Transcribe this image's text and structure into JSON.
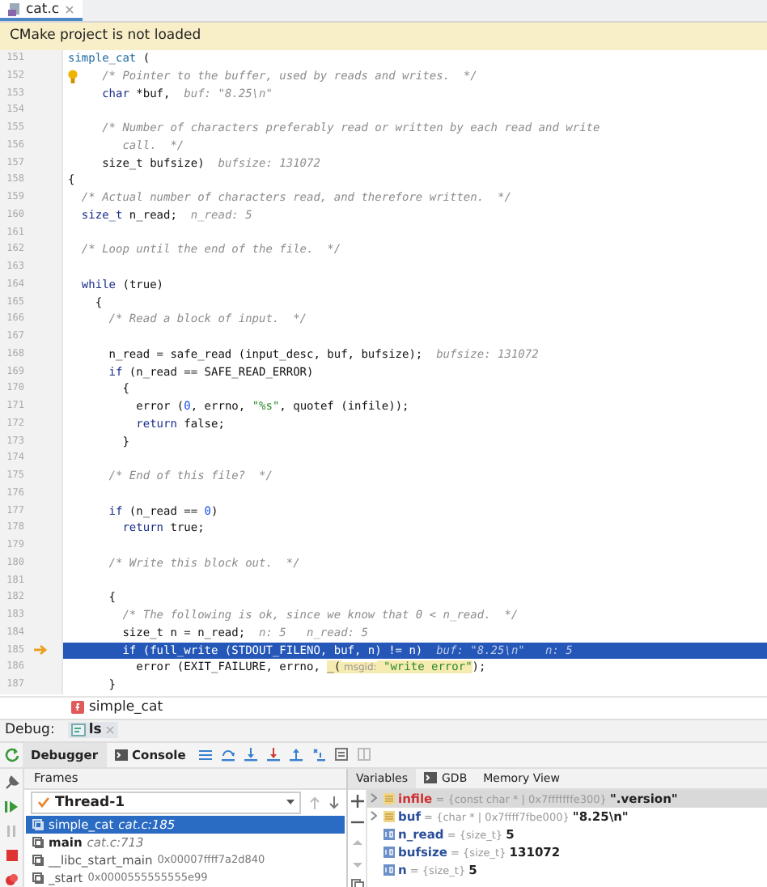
{
  "editor_tabs": [
    {
      "label": "cat.c",
      "selected": true
    }
  ],
  "banner": "CMake project is not loaded",
  "code_lines": [
    {
      "number": "151",
      "kind": "normal",
      "tokens": [
        {
          "kind": "function",
          "text": "simple_cat"
        },
        {
          "kind": "plain",
          "text": " ("
        }
      ]
    },
    {
      "number": "152",
      "kind": "bulb",
      "tokens": [
        {
          "kind": "comment",
          "text": "     /* Pointer to the buffer, used by reads and writes.  */"
        }
      ]
    },
    {
      "number": "153",
      "kind": "normal",
      "tokens": [
        {
          "kind": "keyword",
          "text": "     char"
        },
        {
          "kind": "plain",
          "text": " *buf,"
        },
        {
          "kind": "hint",
          "text": "  buf: \"8.25\\n\""
        }
      ]
    },
    {
      "number": "154",
      "kind": "normal"
    },
    {
      "number": "155",
      "kind": "normal",
      "tokens": [
        {
          "kind": "comment",
          "text": "     /* Number of characters preferably read or written by each read and write"
        }
      ]
    },
    {
      "number": "156",
      "kind": "normal",
      "tokens": [
        {
          "kind": "comment",
          "text": "        call.  */"
        }
      ]
    },
    {
      "number": "157",
      "kind": "normal",
      "tokens": [
        {
          "kind": "plain",
          "text": "     size_t bufsize)"
        },
        {
          "kind": "hint",
          "text": "  bufsize: 131072"
        }
      ]
    },
    {
      "number": "158",
      "kind": "normal",
      "tokens": [
        {
          "kind": "plain",
          "text": "{"
        }
      ]
    },
    {
      "number": "159",
      "kind": "normal",
      "tokens": [
        {
          "kind": "comment",
          "text": "  /* Actual number of characters read, and therefore written.  */"
        }
      ]
    },
    {
      "number": "160",
      "kind": "normal",
      "tokens": [
        {
          "kind": "keyword",
          "text": "  size_t"
        },
        {
          "kind": "plain",
          "text": " n_read;"
        },
        {
          "kind": "hint",
          "text": "  n_read: 5"
        }
      ]
    },
    {
      "number": "161",
      "kind": "normal"
    },
    {
      "number": "162",
      "kind": "normal",
      "tokens": [
        {
          "kind": "comment",
          "text": "  /* Loop until the end of the file.  */"
        }
      ]
    },
    {
      "number": "163",
      "kind": "normal"
    },
    {
      "number": "164",
      "kind": "normal",
      "tokens": [
        {
          "kind": "keyword",
          "text": "  while"
        },
        {
          "kind": "plain",
          "text": " (true)"
        }
      ]
    },
    {
      "number": "165",
      "kind": "normal",
      "tokens": [
        {
          "kind": "plain",
          "text": "    {"
        }
      ]
    },
    {
      "number": "166",
      "kind": "normal",
      "tokens": [
        {
          "kind": "comment",
          "text": "      /* Read a block of input.  */"
        }
      ]
    },
    {
      "number": "167",
      "kind": "normal"
    },
    {
      "number": "168",
      "kind": "normal",
      "tokens": [
        {
          "kind": "plain",
          "text": "      n_read = safe_read (input_desc, buf, bufsize);"
        },
        {
          "kind": "hint",
          "text": "  bufsize: 131072"
        }
      ]
    },
    {
      "number": "169",
      "kind": "normal",
      "tokens": [
        {
          "kind": "keyword",
          "text": "      if"
        },
        {
          "kind": "plain",
          "text": " (n_read == SAFE_READ_ERROR)"
        }
      ]
    },
    {
      "number": "170",
      "kind": "normal",
      "tokens": [
        {
          "kind": "plain",
          "text": "        {"
        }
      ]
    },
    {
      "number": "171",
      "kind": "normal",
      "tokens": [
        {
          "kind": "plain",
          "text": "          error ("
        },
        {
          "kind": "number",
          "text": "0"
        },
        {
          "kind": "plain",
          "text": ", errno, "
        },
        {
          "kind": "string",
          "text": "\"%s\""
        },
        {
          "kind": "plain",
          "text": ", quotef (infile));"
        }
      ]
    },
    {
      "number": "172",
      "kind": "normal",
      "tokens": [
        {
          "kind": "keyword",
          "text": "          return"
        },
        {
          "kind": "plain",
          "text": " false;"
        }
      ]
    },
    {
      "number": "173",
      "kind": "normal",
      "tokens": [
        {
          "kind": "plain",
          "text": "        }"
        }
      ]
    },
    {
      "number": "174",
      "kind": "normal"
    },
    {
      "number": "175",
      "kind": "normal",
      "tokens": [
        {
          "kind": "comment",
          "text": "      /* End of this file?  */"
        }
      ]
    },
    {
      "number": "176",
      "kind": "normal"
    },
    {
      "number": "177",
      "kind": "normal",
      "tokens": [
        {
          "kind": "keyword",
          "text": "      if"
        },
        {
          "kind": "plain",
          "text": " (n_read == "
        },
        {
          "kind": "number",
          "text": "0"
        },
        {
          "kind": "plain",
          "text": ")"
        }
      ]
    },
    {
      "number": "178",
      "kind": "normal",
      "tokens": [
        {
          "kind": "keyword",
          "text": "        return"
        },
        {
          "kind": "plain",
          "text": " true;"
        }
      ]
    },
    {
      "number": "179",
      "kind": "normal"
    },
    {
      "number": "180",
      "kind": "normal",
      "tokens": [
        {
          "kind": "comment",
          "text": "      /* Write this block out.  */"
        }
      ]
    },
    {
      "number": "181",
      "kind": "normal"
    },
    {
      "number": "182",
      "kind": "normal",
      "tokens": [
        {
          "kind": "plain",
          "text": "      {"
        }
      ]
    },
    {
      "number": "183",
      "kind": "normal",
      "tokens": [
        {
          "kind": "comment",
          "text": "        /* The following is ok, since we know that 0 < n_read.  */"
        }
      ]
    },
    {
      "number": "184",
      "kind": "normal",
      "tokens": [
        {
          "kind": "plain",
          "text": "        size_t n = n_read;"
        },
        {
          "kind": "hint",
          "text": "  n: 5   n_read: 5"
        }
      ]
    },
    {
      "number": "185",
      "kind": "current",
      "tokens": [
        {
          "kind": "plain",
          "text": "        if (full_write (STDOUT_FILENO, buf, n) != n)"
        },
        {
          "kind": "hint",
          "text": "  buf: \"8.25\\n\"   n: 5"
        }
      ]
    },
    {
      "number": "186",
      "kind": "normal",
      "tokens": [
        {
          "kind": "plain",
          "text": "          error (EXIT_FAILURE, errno, "
        },
        {
          "kind": "marked",
          "text": "_("
        },
        {
          "kind": "marked-param",
          "text": " msgid:"
        },
        {
          "kind": "marked-string",
          "text": " \"write error\""
        },
        {
          "kind": "plain",
          "text": ");"
        }
      ]
    },
    {
      "number": "187",
      "kind": "normal",
      "tokens": [
        {
          "kind": "plain",
          "text": "      }"
        }
      ]
    }
  ],
  "breadcrumb": "simple_cat",
  "debug": {
    "label": "Debug:",
    "sessions": [
      {
        "label": "ls",
        "selected": true
      }
    ]
  },
  "debug_tabs": [
    {
      "label": "Debugger",
      "selected": true
    },
    {
      "label": "Console",
      "selected": false
    }
  ],
  "frames": {
    "title": "Frames",
    "thread": "Thread-1",
    "items": [
      {
        "function": "simple_cat",
        "location": "cat.c:185",
        "kind": "source",
        "selected": true
      },
      {
        "function": "main",
        "location": "cat.c:713",
        "kind": "source",
        "selected": false
      },
      {
        "function": "__libc_start_main",
        "location": "0x00007ffff7a2d840",
        "kind": "address",
        "selected": false
      },
      {
        "function": "_start",
        "location": "0x0000555555555e99",
        "kind": "address",
        "selected": false
      }
    ]
  },
  "variables": {
    "tabs": [
      {
        "label": "Variables",
        "selected": true
      },
      {
        "label": "GDB",
        "selected": false
      },
      {
        "label": "Memory View",
        "selected": false
      }
    ],
    "items": [
      {
        "name": "infile",
        "type": "= {const char * | 0x7fffffffe300}",
        "value": "\".version\"",
        "kind": "pointer",
        "expandable": true,
        "changed": true,
        "selected": true
      },
      {
        "name": "buf",
        "type": "= {char * | 0x7ffff7fbe000}",
        "value": "\"8.25\\n\"",
        "kind": "pointer",
        "expandable": true,
        "changed": false,
        "selected": false
      },
      {
        "name": "n_read",
        "type": "= {size_t}",
        "value": "5",
        "kind": "primitive",
        "expandable": false,
        "changed": false,
        "selected": false
      },
      {
        "name": "bufsize",
        "type": "= {size_t}",
        "value": "131072",
        "kind": "primitive",
        "expandable": false,
        "changed": false,
        "selected": false
      },
      {
        "name": "n",
        "type": "= {size_t}",
        "value": "5",
        "kind": "primitive",
        "expandable": false,
        "changed": false,
        "selected": false
      }
    ]
  }
}
